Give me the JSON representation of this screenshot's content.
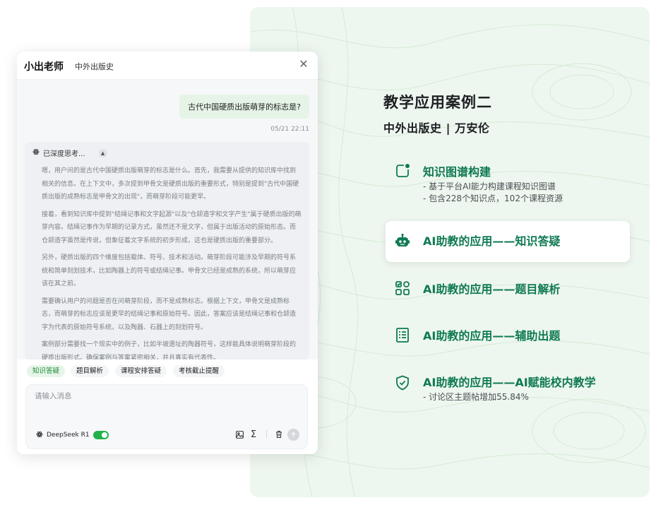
{
  "showcase": {
    "title": "教学应用案例二",
    "subtitle": "中外出版史 | 万安伦",
    "features": [
      {
        "title": "知识图谱构建",
        "icon": "knowledge-graph-icon",
        "details": [
          "- 基于平台AI能力构建课程知识图谱",
          "- 包含228个知识点，102个课程资源"
        ]
      },
      {
        "title": "AI助教的应用——知识答疑",
        "icon": "robot-icon",
        "details": []
      },
      {
        "title": "AI助教的应用——题目解析",
        "icon": "apps-grid-icon",
        "details": []
      },
      {
        "title": "AI助教的应用——辅助出题",
        "icon": "document-list-icon",
        "details": []
      },
      {
        "title": "AI助教的应用——AI赋能校内教学",
        "icon": "shield-check-icon",
        "details": [
          "- 讨论区主题帖增加55.84%"
        ]
      }
    ],
    "colors": {
      "panel_bg": "#eef7ef",
      "accent": "#0f7a52"
    }
  },
  "chat": {
    "assistant_name": "小出老师",
    "course": "中外出版史",
    "close_icon": "close-icon",
    "user_message": "古代中国硬质出版萌芽的标志是?",
    "timestamp": "05/21 22:11",
    "thinking": {
      "label": "已深度思考...",
      "paragraphs": [
        "嗯，用户问的是古代中国硬质出版萌芽的标志是什么。首先，我需要从提供的知识库中找到相关的信息。在上下文中，多次提到甲骨文是硬质出版的重要形式，特别是提到\"古代中国硬质出版的成熟标志是甲骨文的出现\"，而萌芽阶段可能更早。",
        "接着，看到知识库中提到\"结绳记事和文字起源\"以及\"仓颉造字和文字产生\"属于硬质出版的萌芽内容。结绳记事作为早期的记录方式，虽然还不是文字，但属于出版活动的原始形态。而仓颉造字虽然是传说，但象征着文字系统的初步形成，这也是硬质出版的重要部分。",
        "另外，硬质出版的四个维度包括载体、符号、技术和活动。萌芽阶段可能涉及早期的符号系统和简单刻划技术，比如陶器上的符号或结绳记事。甲骨文已经是成熟的系统，所以萌芽应该在其之前。",
        "需要确认用户的问题是否在问萌芽阶段，而不是成熟标志。根据上下文，甲骨文是成熟标志，而萌芽的标志应该是更早的结绳记事和原始符号。因此，答案应该是结绳记事和仓颉造字为代表的原始符号系统，以及陶器、石器上的刻划符号。",
        "案例部分需要找一个现实中的例子，比如半坡遗址的陶器符号，这样能具体说明萌芽阶段的硬质出版形式。确保案例与答案紧密相关，并且真实有代表性。"
      ]
    },
    "quick_actions": [
      "知识答疑",
      "题目解析",
      "课程安排答疑",
      "考核截止提醒"
    ],
    "input": {
      "placeholder": "请输入消息",
      "value": ""
    },
    "model": {
      "name": "DeepSeek R1",
      "enabled": true
    },
    "tools": [
      "image-icon",
      "sigma-icon",
      "trash-icon",
      "send-icon"
    ]
  }
}
